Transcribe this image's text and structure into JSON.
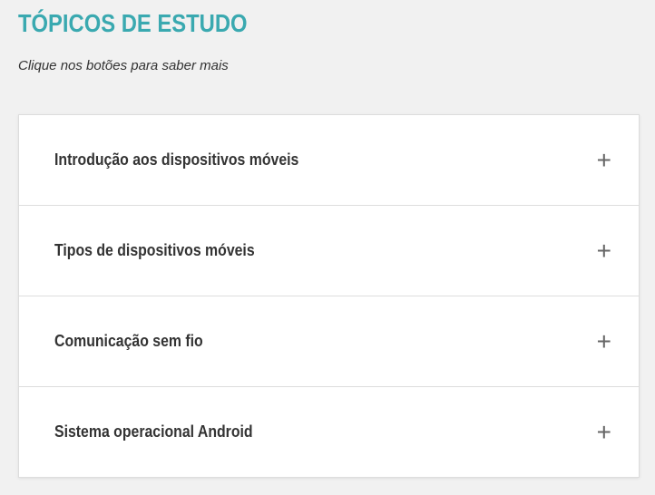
{
  "header": {
    "title": "TÓPICOS DE ESTUDO",
    "subtitle": "Clique nos botões para saber mais"
  },
  "accordion": {
    "items": [
      {
        "label": "Introdução aos dispositivos móveis"
      },
      {
        "label": "Tipos de dispositivos móveis"
      },
      {
        "label": "Comunicação sem fio"
      },
      {
        "label": "Sistema operacional Android"
      }
    ],
    "expand_icon": "plus-icon"
  }
}
